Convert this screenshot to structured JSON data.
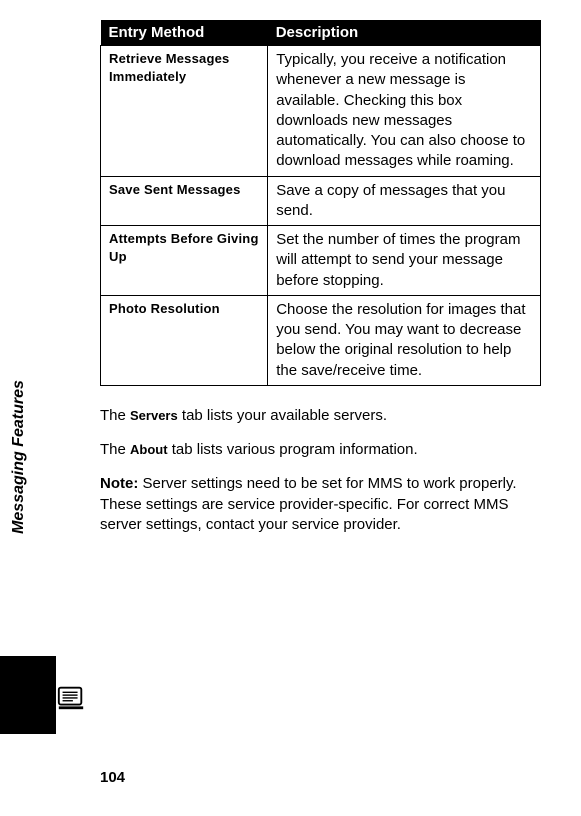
{
  "sidebar": {
    "label": "Messaging Features"
  },
  "page_number": "104",
  "table": {
    "headers": {
      "col1": "Entry Method",
      "col2": "Description"
    },
    "rows": [
      {
        "label": "Retrieve Messages Immediately",
        "desc": "Typically, you receive a notification whenever a new message is available. Checking this box downloads new messages automatically. You can also choose to download messages while roaming."
      },
      {
        "label": "Save Sent Messages",
        "desc": "Save a copy of messages that you send."
      },
      {
        "label": "Attempts Before Giving Up",
        "desc": "Set the number of times the program will attempt to send your message before stopping."
      },
      {
        "label": "Photo Resolution",
        "desc": "Choose the resolution for images that you send. You may want to decrease below the original resolution to help the save/receive time."
      }
    ]
  },
  "paragraphs": {
    "servers_pre": "The ",
    "servers_bold": "Servers",
    "servers_post": " tab lists your available servers.",
    "about_pre": "The ",
    "about_bold": "About",
    "about_post": " tab lists various program information."
  },
  "note": {
    "lead": "Note:",
    "body": " Server settings need to be set for MMS to work properly. These settings are service provider-specific. For correct MMS server settings, contact your service provider."
  }
}
